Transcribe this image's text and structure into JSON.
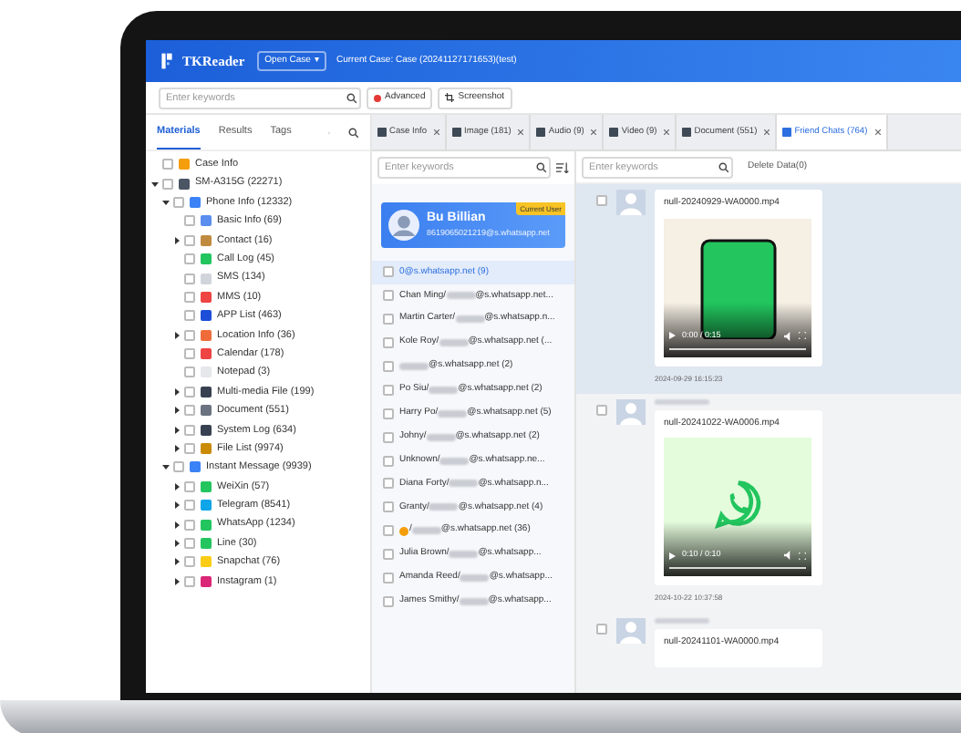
{
  "header": {
    "app_name": "TKReader",
    "open_case": "Open Case",
    "caret": "▾",
    "current_case": "Current Case: Case (20241127171653)(test)"
  },
  "toolbar": {
    "search": {
      "placeholder": "Enter keywords"
    },
    "buttons": [
      "Advanced",
      "Screenshot"
    ]
  },
  "left_panel": {
    "tabs": [
      {
        "label": "Materials",
        "selected": true
      },
      {
        "label": "Results",
        "selected": false
      },
      {
        "label": "Tags",
        "selected": false
      }
    ],
    "tree": [
      {
        "label": "Case Info",
        "checked": false
      },
      {
        "label": "SM-A315G (22271)",
        "checked": false,
        "expanded": true,
        "children": [
          {
            "label": "Phone Info (12332)",
            "checked": false,
            "expanded": true,
            "children": [
              {
                "label": "Basic Info (69)",
                "checked": false
              },
              {
                "label": "Contact (16)",
                "checked": false,
                "expanded": false
              },
              {
                "label": "Call Log (45)",
                "checked": false
              },
              {
                "label": "SMS (134)",
                "checked": false
              },
              {
                "label": "MMS (10)",
                "checked": false
              },
              {
                "label": "APP List (463)",
                "checked": false
              },
              {
                "label": "Location Info (36)",
                "checked": false,
                "expanded": false
              },
              {
                "label": "Calendar (178)",
                "checked": false
              },
              {
                "label": "Notepad (3)",
                "checked": false
              },
              {
                "label": "Multi-media File (199)",
                "checked": false,
                "expanded": false
              },
              {
                "label": "Document (551)",
                "checked": false,
                "expanded": false
              },
              {
                "label": "System Log (634)",
                "checked": false,
                "expanded": false
              },
              {
                "label": "File List (9974)",
                "checked": false,
                "expanded": false
              }
            ]
          },
          {
            "label": "Instant Message (9939)",
            "checked": false,
            "expanded": true,
            "children": [
              {
                "label": "WeiXin (57)",
                "checked": false,
                "expanded": false
              },
              {
                "label": "Telegram (8541)",
                "checked": false,
                "expanded": false
              },
              {
                "label": "WhatsApp (1234)",
                "checked": false,
                "expanded": false
              },
              {
                "label": "Line (30)",
                "checked": false,
                "expanded": false
              },
              {
                "label": "Snapchat (76)",
                "checked": false,
                "expanded": false
              },
              {
                "label": "Instagram (1)",
                "checked": false,
                "expanded": false
              }
            ]
          }
        ]
      }
    ]
  },
  "tabs": [
    {
      "label": "Case Info",
      "selected": false
    },
    {
      "label": "Image (181)",
      "selected": false
    },
    {
      "label": "Audio (9)",
      "selected": false
    },
    {
      "label": "Video (9)",
      "selected": false
    },
    {
      "label": "Document (551)",
      "selected": false
    },
    {
      "label": "Friend Chats (764)",
      "selected": true
    }
  ],
  "contacts_panel": {
    "search": {
      "placeholder": "Enter keywords"
    },
    "current_user": {
      "name": "Bu Billian",
      "account": "8619065021219@s.whatsapp.net",
      "badge": "Current User"
    },
    "contacts": [
      {
        "name": "0@s.whatsapp.net (9)",
        "redacted": false,
        "selected": true,
        "checked": false
      },
      {
        "name": "Chan Ming/",
        "redacted": true,
        "suffix": "@s.whatsapp.net...",
        "selected": false,
        "checked": false
      },
      {
        "name": "Martin Carter/",
        "redacted": true,
        "suffix": "@s.whatsapp.n...",
        "selected": false,
        "checked": false
      },
      {
        "name": "Kole Roy/",
        "redacted": true,
        "suffix": "@s.whatsapp.net (...",
        "selected": false,
        "checked": false
      },
      {
        "redacted": true,
        "suffix": "@s.whatsapp.net (2)",
        "selected": false,
        "checked": false
      },
      {
        "name": "Po Siu/",
        "redacted": true,
        "suffix": "@s.whatsapp.net (2)",
        "selected": false,
        "checked": false
      },
      {
        "name": "Harry Po/",
        "redacted": true,
        "suffix": "@s.whatsapp.net (5)",
        "selected": false,
        "checked": false
      },
      {
        "name": "Johny/",
        "redacted": true,
        "suffix": "@s.whatsapp.net (2)",
        "selected": false,
        "checked": false
      },
      {
        "name": "Unknown/",
        "redacted": true,
        "suffix": "@s.whatsapp.ne...",
        "selected": false,
        "checked": false
      },
      {
        "name": "Diana Forty/",
        "redacted": true,
        "suffix": "@s.whatsapp.n...",
        "selected": false,
        "checked": false
      },
      {
        "name": "Granty/",
        "redacted": true,
        "suffix": "@s.whatsapp.net (4)",
        "selected": false,
        "checked": false
      },
      {
        "kind": "emoji",
        "name": "/",
        "redacted": true,
        "suffix": "@s.whatsapp.net (36)",
        "selected": false,
        "checked": false
      },
      {
        "name": "Julia Brown/",
        "redacted": true,
        "suffix": "@s.whatsapp...",
        "selected": false,
        "checked": false
      },
      {
        "name": "Amanda Reed/",
        "redacted": true,
        "suffix": "@s.whatsapp...",
        "selected": false,
        "checked": false
      },
      {
        "name": "James Smithy/",
        "redacted": true,
        "suffix": "@s.whatsapp...",
        "selected": false,
        "checked": false
      }
    ]
  },
  "chat_panel": {
    "search": {
      "placeholder": "Enter keywords"
    },
    "delete": "Delete Data(0)",
    "messages": [
      {
        "selected": true,
        "checked": false,
        "sender_redacted": false,
        "file": "null-20240929-WA0000.mp4",
        "kind": "phone_video",
        "time": "0:00 / 0:15",
        "timestamp": "2024-09-29 16:15:23"
      },
      {
        "selected": false,
        "checked": false,
        "sender_redacted": true,
        "file": "null-20241022-WA0006.mp4",
        "kind": "logo_video",
        "time": "0:10 / 0:10",
        "timestamp": "2024-10-22 10:37:58"
      },
      {
        "selected": false,
        "checked": false,
        "sender_redacted": true,
        "file": "null-20241101-WA0000.mp4"
      }
    ]
  }
}
